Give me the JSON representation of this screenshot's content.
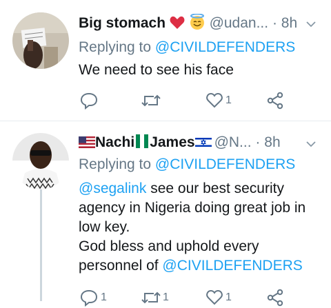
{
  "tweets": [
    {
      "name": "Big stomach",
      "handle": "@udan...",
      "dot": "·",
      "time": "8h",
      "replying_label": "Replying to",
      "replying_to": "@CIVILDEFENDERS",
      "text": "We need to see his face",
      "actions": {
        "replies": "",
        "retweets": "",
        "likes": "1"
      }
    },
    {
      "name": "Nachi",
      "name2": "James",
      "handle": "@N...",
      "dot": "·",
      "time": "8h",
      "replying_label": "Replying to",
      "replying_to": "@CIVILDEFENDERS",
      "text_mention": "@segalink",
      "text_body": " see our best security agency in Nigeria doing great job in low key.",
      "text_line2": "God bless and uphold every personnel of ",
      "text_mention2": "@CIVILDEFENDERS",
      "actions": {
        "replies": "1",
        "retweets": "1",
        "likes": "1"
      }
    }
  ],
  "colors": {
    "accent": "#1da1f2",
    "muted": "#657786",
    "text": "#14171a",
    "heart": "#e0245e"
  }
}
